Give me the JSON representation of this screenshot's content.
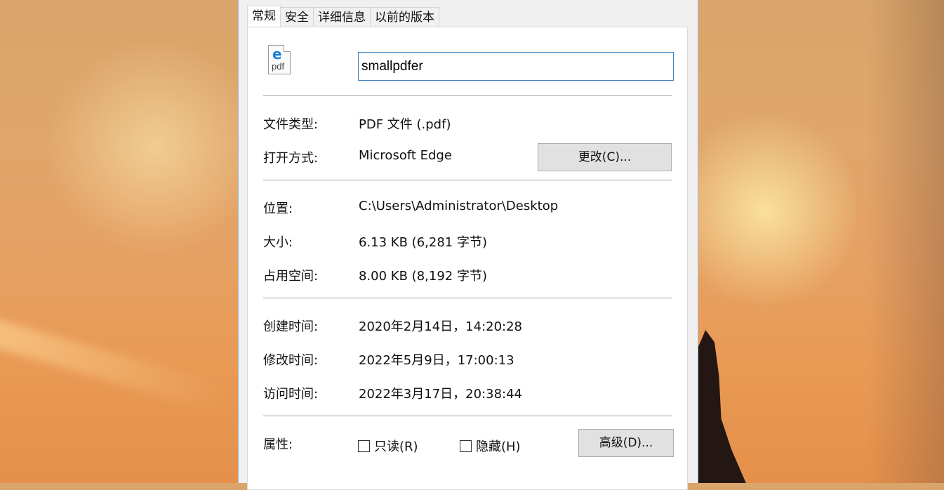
{
  "tabs": [
    {
      "label": "常规",
      "active": true
    },
    {
      "label": "安全",
      "active": false
    },
    {
      "label": "详细信息",
      "active": false
    },
    {
      "label": "以前的版本",
      "active": false
    }
  ],
  "file": {
    "icon": "edge-pdf-file-icon",
    "icon_letter": "e",
    "icon_text": "pdf",
    "name": "smallpdfer"
  },
  "type_row": {
    "label": "文件类型:",
    "value": "PDF 文件 (.pdf)"
  },
  "open_with": {
    "label": "打开方式:",
    "value": "Microsoft Edge",
    "button": "更改(C)..."
  },
  "location": {
    "label": "位置:",
    "value": "C:\\Users\\Administrator\\Desktop"
  },
  "size": {
    "label": "大小:",
    "value": "6.13 KB (6,281 字节)"
  },
  "size_on_disk": {
    "label": "占用空间:",
    "value": "8.00 KB (8,192 字节)"
  },
  "created": {
    "label": "创建时间:",
    "value": "2020年2月14日，14:20:28"
  },
  "modified": {
    "label": "修改时间:",
    "value": "2022年5月9日，17:00:13"
  },
  "accessed": {
    "label": "访问时间:",
    "value": "2022年3月17日，20:38:44"
  },
  "attributes": {
    "label": "属性:",
    "readonly": {
      "label": "只读(R)",
      "checked": false
    },
    "hidden": {
      "label": "隐藏(H)",
      "checked": false
    },
    "advanced_button": "高级(D)..."
  },
  "colors": {
    "accent": "#3b7fbf",
    "button": "#e1e1e1",
    "panel": "#ffffff",
    "dialog": "#f0f0f0"
  }
}
